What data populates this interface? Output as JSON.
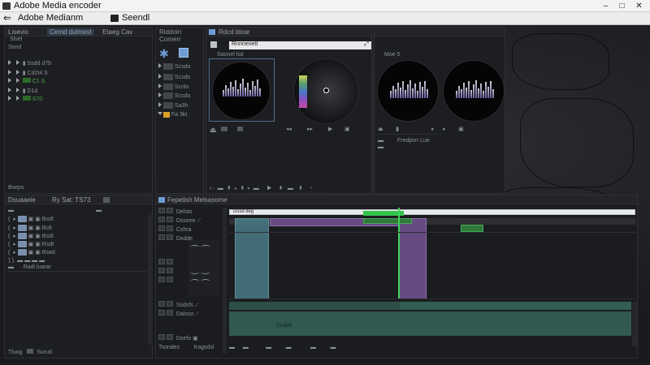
{
  "window": {
    "title": "Adobe Media encoder",
    "buttons": [
      "–",
      "□",
      "✕"
    ]
  },
  "menubar": {
    "back_icon": "back-arrow-icon",
    "items": [
      "Adobe Medianm",
      "Seendl"
    ]
  },
  "project_panel": {
    "tabs": [
      "Lisevio",
      "Cemd dulmest",
      "Etaeg Cav"
    ],
    "subtitle": "Slsel",
    "filter": "Snnd",
    "items": [
      "Ssdd d7b",
      "Cd2t4 S",
      "C1 S",
      "D1d",
      "S70"
    ],
    "footer": "Bseps"
  },
  "effects_panel": {
    "title": "Riddoiri\nComerr",
    "items": [
      "Scsdo",
      "Scsdo",
      "Scnlo",
      "Scsdo",
      "Sa3h",
      "Fa 3kt"
    ]
  },
  "source_monitor": {
    "tab": "Rdcd ldoar",
    "filename": "Rnnnenett",
    "label": "Saonel lsd",
    "toggle": "",
    "transport_count": 9
  },
  "program_monitor": {
    "tab": "",
    "label": "Moe 5",
    "sub_label": "Fredpon Lue"
  },
  "audio_panel": {
    "tabs": [
      "Dsuaaeie",
      "Ry Sat: TS73"
    ],
    "tracks": [
      "Bsdt",
      "Bolt",
      "Bsdt",
      "Rsdt",
      "Bsad"
    ],
    "master_label": "Radi luarar",
    "footer": [
      "Tluog",
      "Surud"
    ]
  },
  "timeline": {
    "tab": "Fepetish Melsasome",
    "ruler_label": "Dssd iteg",
    "tracks": [
      {
        "name": "Delsto",
        "kind": "video"
      },
      {
        "name": "Dsseee",
        "kind": "video"
      },
      {
        "name": "Cshra",
        "kind": "video"
      },
      {
        "name": "Dsdde",
        "kind": "video"
      },
      {
        "name": "Ssdsfs",
        "kind": "audio"
      },
      {
        "name": "Dalsso",
        "kind": "audio"
      },
      {
        "name": "Dsefo",
        "kind": "audio"
      }
    ],
    "audio_label": "Scaldi",
    "footer": [
      "Tsondes",
      "Kagsdsl"
    ],
    "colors": {
      "teal": "#4a7c86",
      "purple": "#6d4f8c",
      "green": "#2f7a3a",
      "audio": "#3b7465"
    }
  }
}
